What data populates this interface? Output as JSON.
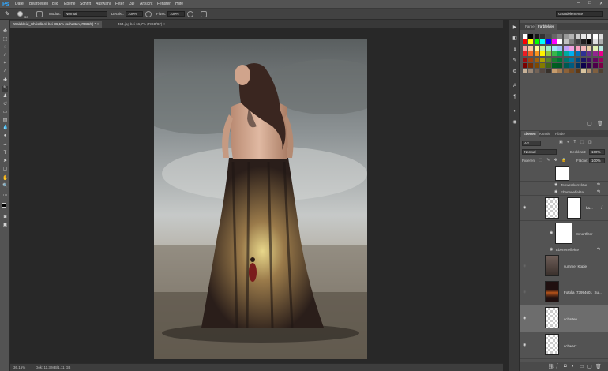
{
  "app": {
    "logo": "Ps"
  },
  "menu": [
    "Datei",
    "Bearbeiten",
    "Bild",
    "Ebene",
    "Schrift",
    "Auswahl",
    "Filter",
    "3D",
    "Ansicht",
    "Fenster",
    "Hilfe"
  ],
  "window_controls": [
    "–",
    "□",
    "✕"
  ],
  "options": {
    "brush_size": "30",
    "mode_label": "Modus:",
    "mode_value": "Normal",
    "opacity_label": "Deckkr.:",
    "opacity_value": "100%",
    "flow_label": "Fluss:",
    "flow_value": "100%",
    "workspace": "Grundelemente"
  },
  "tabs": [
    {
      "label": "Waldkleid_Christlla.tif bei 36,1% (schatten, RGB/8) *  ×",
      "active": true
    },
    {
      "label": "454.jpg bei 66,7% (RGB/8#)  ×",
      "active": false
    }
  ],
  "status": {
    "zoom": "36,15%",
    "doc": "Dok: 11,3 MB/1,11 GB"
  },
  "color_panel": {
    "tabs": [
      "Farbe",
      "Farbfelder"
    ],
    "active": 1
  },
  "layers_panel": {
    "tabs": [
      "Ebenen",
      "Kanäle",
      "Pfade"
    ],
    "active": 0,
    "filter_kind": "Art",
    "blend_mode": "Normal",
    "opacity_label": "Deckkraft:",
    "opacity_value": "100%",
    "lock_label": "Fixieren:",
    "fill_label": "Fläche:",
    "fill_value": "100%",
    "layers": [
      {
        "name": "",
        "kind": "mask-top"
      },
      {
        "name": "Tonwertkorrektur",
        "kind": "sub"
      },
      {
        "name": "Ebeneneffekte",
        "kind": "sub"
      },
      {
        "name": "ha...",
        "kind": "smart"
      },
      {
        "name": "Smartfilter",
        "kind": "sub"
      },
      {
        "name": "Ebeneneffekte",
        "kind": "sub"
      },
      {
        "name": "summer Kopie",
        "kind": "layer"
      },
      {
        "name": "Fotolia_73994601_Su...",
        "kind": "layer"
      },
      {
        "name": "schatten",
        "kind": "layer"
      },
      {
        "name": "schwarz",
        "kind": "layer"
      }
    ]
  },
  "swatch_colors": [
    "#ffffff",
    "#000000",
    "#1a1a1a",
    "#333333",
    "#4d4d4d",
    "#666666",
    "#808080",
    "#999999",
    "#b3b3b3",
    "#cccccc",
    "#e6e6e6",
    "#f2f2f2",
    "#ffffff",
    "#dddddd",
    "#ff0000",
    "#ffff00",
    "#00ff00",
    "#00ffff",
    "#0000ff",
    "#ff00ff",
    "#ffffff",
    "#c0c0c0",
    "#808080",
    "#404040",
    "#202020",
    "#000000",
    "#e0e0e0",
    "#b0b0b0",
    "#f4a0a0",
    "#f8c8a0",
    "#fff4a0",
    "#c8f0a0",
    "#a0f0c8",
    "#a0e8f8",
    "#a0c0f8",
    "#c0a0f8",
    "#f0a0e0",
    "#f8a0c0",
    "#f0b8b8",
    "#e8d0a8",
    "#e0f0b0",
    "#b8e8e0",
    "#ed1c24",
    "#f26522",
    "#f7941d",
    "#fff200",
    "#8dc63f",
    "#39b54a",
    "#00a651",
    "#00a99d",
    "#00aeef",
    "#0072bc",
    "#2e3192",
    "#662d91",
    "#92278f",
    "#ec008c",
    "#9e0b0f",
    "#a0410d",
    "#a36209",
    "#aba000",
    "#598527",
    "#197b30",
    "#007236",
    "#00746b",
    "#0076a3",
    "#004a80",
    "#1b1464",
    "#440e62",
    "#630460",
    "#9e005d",
    "#790000",
    "#7b2e00",
    "#7d4900",
    "#827b00",
    "#406618",
    "#005e20",
    "#005826",
    "#005952",
    "#005b7f",
    "#003663",
    "#0d004c",
    "#32004b",
    "#4b0049",
    "#7b0046",
    "#c7b299",
    "#998675",
    "#736357",
    "#534741",
    "#37302a",
    "#c69c6d",
    "#a67c52",
    "#8c6239",
    "#754c24",
    "#603913",
    "#d9c5a0",
    "#b09070",
    "#806040",
    "#504030"
  ]
}
